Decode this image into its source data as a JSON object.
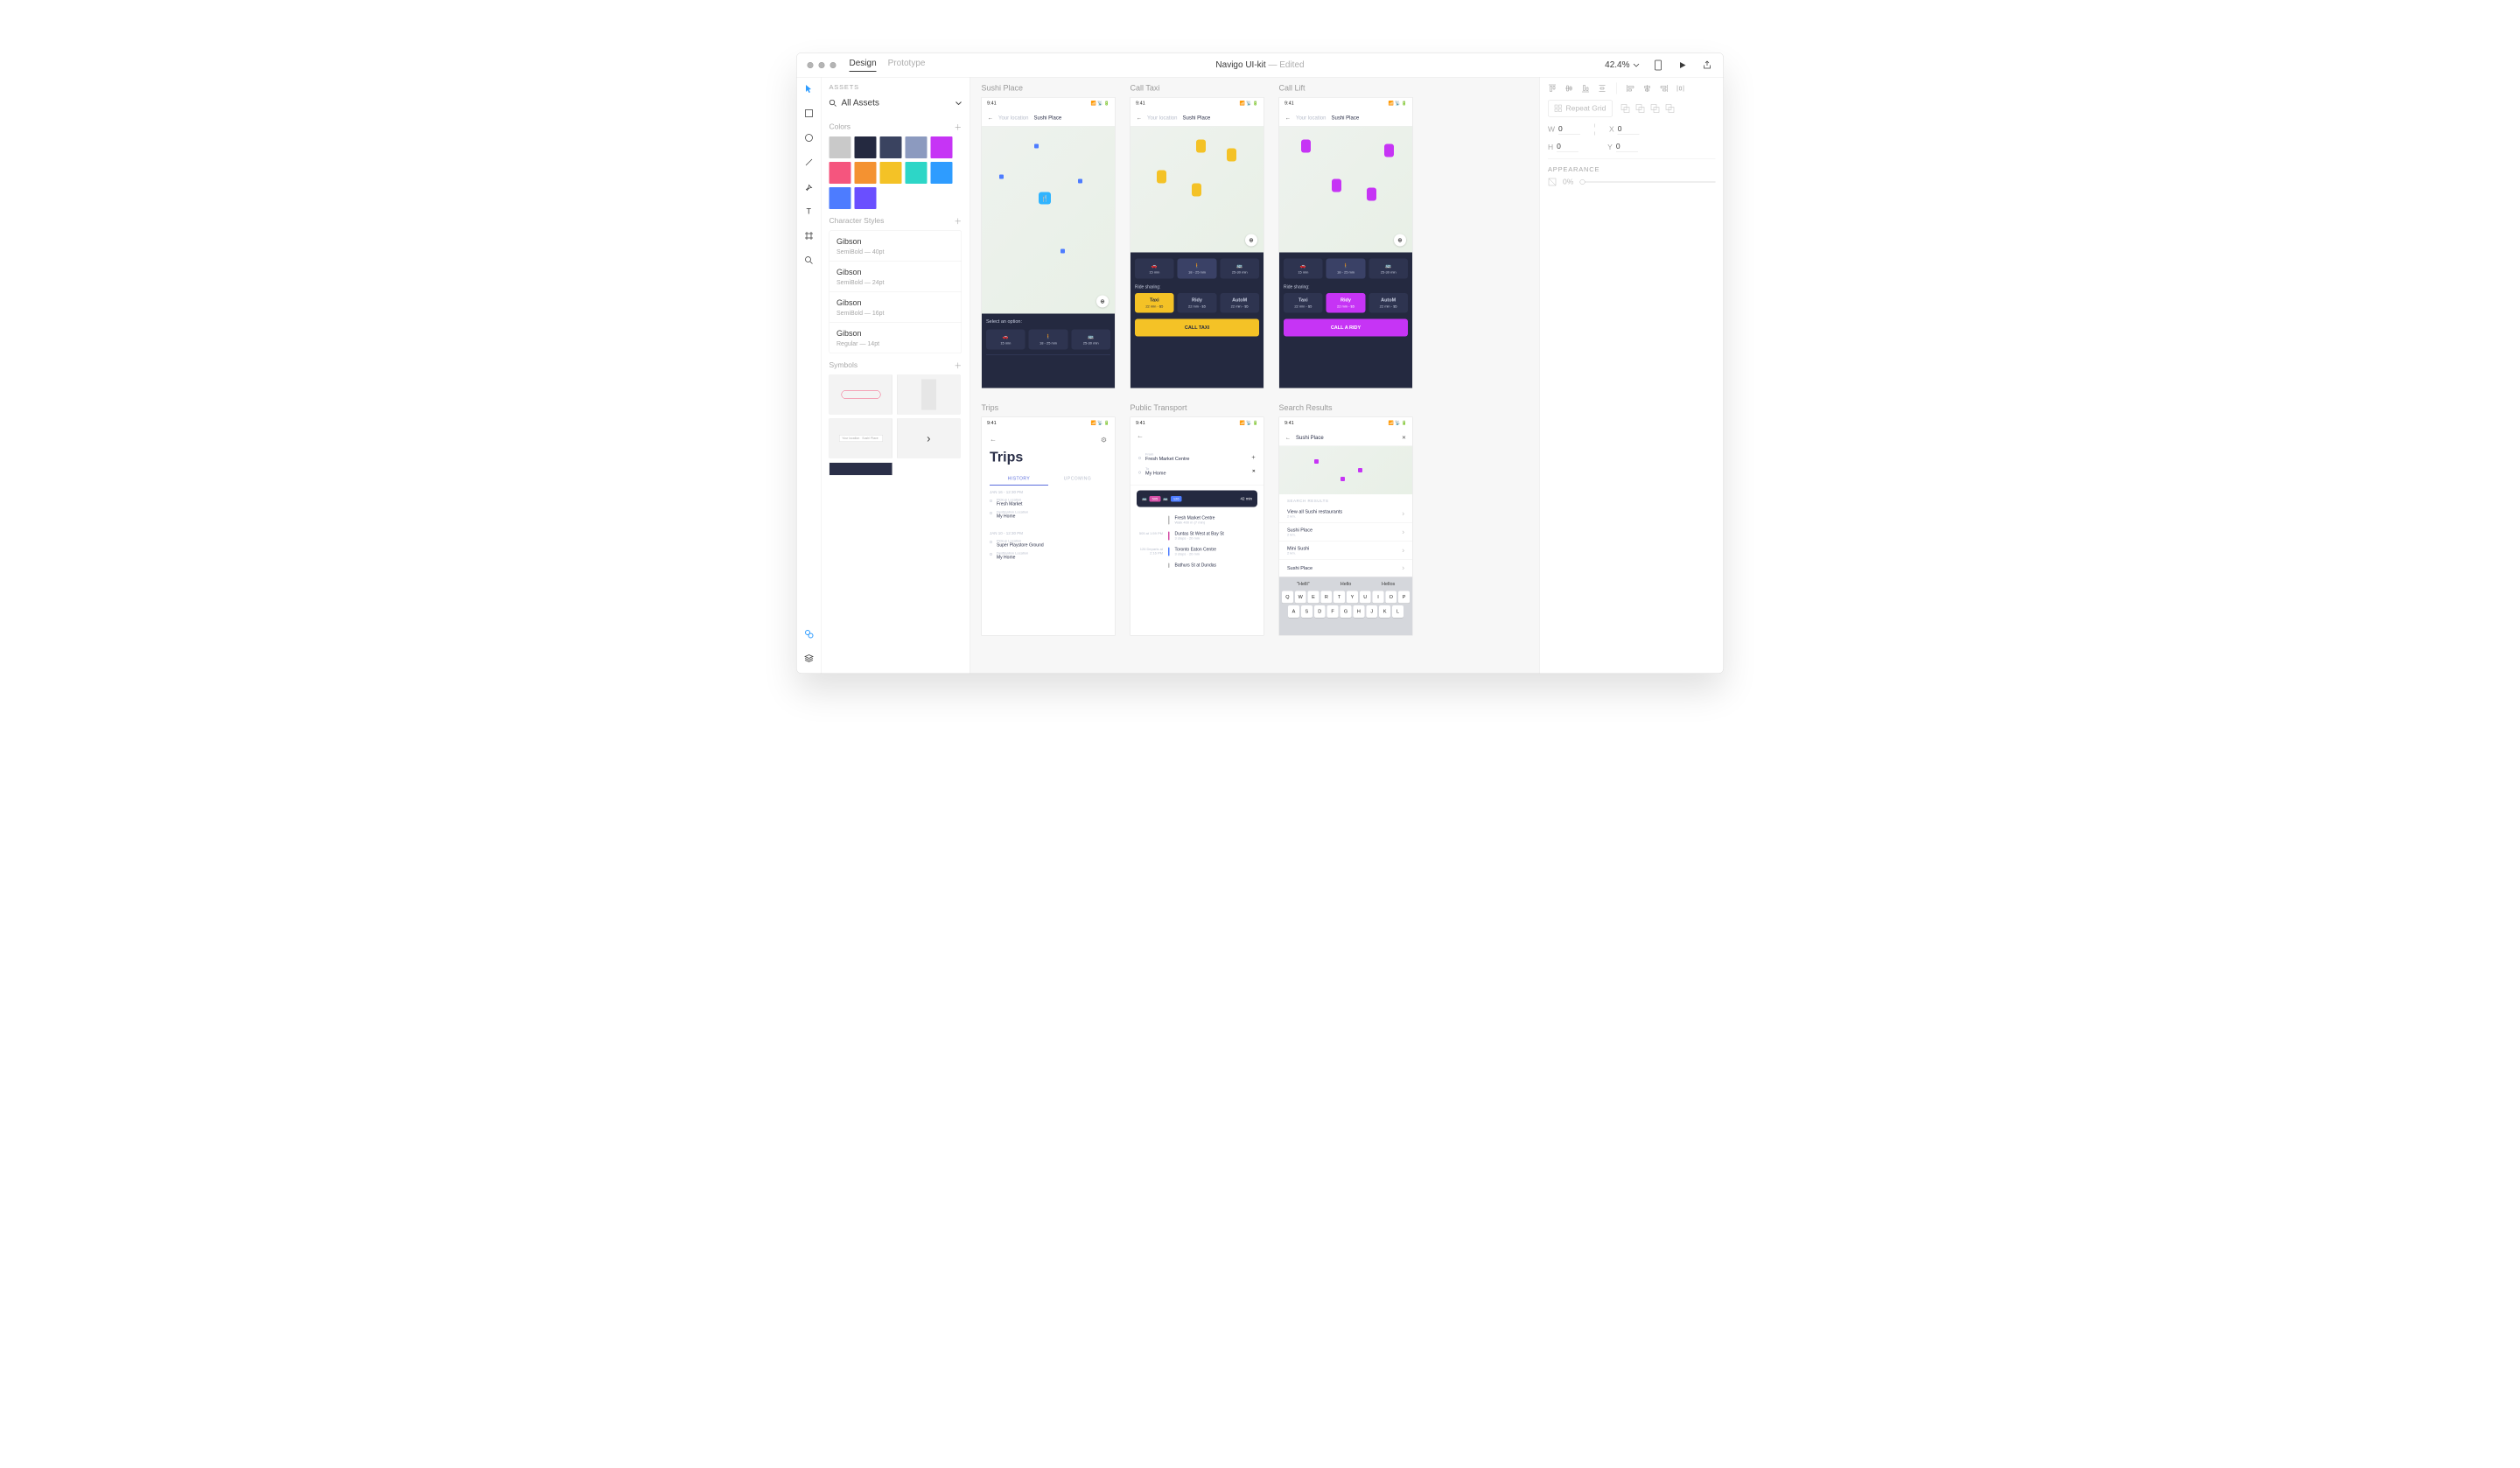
{
  "titlebar": {
    "tab_design": "Design",
    "tab_prototype": "Prototype",
    "doc_name": "Navigo UI-kit",
    "doc_status": "Edited",
    "zoom": "42.4%"
  },
  "assets": {
    "title": "ASSETS",
    "selector": "All Assets",
    "colors_title": "Colors",
    "colors": [
      "#c9c9c9",
      "#242940",
      "#3a4360",
      "#8c9abf",
      "#c634f5",
      "#f5557e",
      "#f49231",
      "#f4c226",
      "#2dd6c7",
      "#2e9cff",
      "#4d7cff",
      "#6a4fff"
    ],
    "char_styles_title": "Character Styles",
    "styles": [
      {
        "name": "Gibson",
        "meta": "SemiBold — 40pt"
      },
      {
        "name": "Gibson",
        "meta": "SemiBold — 24pt"
      },
      {
        "name": "Gibson",
        "meta": "SemiBold — 16pt"
      },
      {
        "name": "Gibson",
        "meta": "Regular — 14pt"
      }
    ],
    "symbols_title": "Symbols"
  },
  "artboards": {
    "sushi": {
      "title": "Sushi Place",
      "time": "9:41",
      "your_location": "Your location",
      "dest": "Sushi Place",
      "select_label": "Select an option:",
      "opts": [
        {
          "icon": "🚗",
          "label": "15 min"
        },
        {
          "icon": "🚶",
          "label": "18 - 25 min"
        },
        {
          "icon": "🚌",
          "label": "25-30 min"
        }
      ]
    },
    "taxi": {
      "title": "Call Taxi",
      "time": "9:41",
      "your_location": "Your location",
      "dest": "Sushi Place",
      "opts": [
        {
          "icon": "🚗",
          "label": "15 min"
        },
        {
          "icon": "🚶",
          "label": "18 - 25 min"
        },
        {
          "icon": "🚌",
          "label": "25-30 min"
        }
      ],
      "share_label": "Ride sharing:",
      "shares": [
        {
          "name": "Taxi",
          "sub": "22 min - $5"
        },
        {
          "name": "Ridy",
          "sub": "22 min - $5"
        },
        {
          "name": "AutoM",
          "sub": "22 min - $5"
        }
      ],
      "cta": "CALL TAXI"
    },
    "lift": {
      "title": "Call Lift",
      "time": "9:41",
      "your_location": "Your location",
      "dest": "Sushi Place",
      "opts": [
        {
          "icon": "🚗",
          "label": "15 min"
        },
        {
          "icon": "🚶",
          "label": "18 - 25 min"
        },
        {
          "icon": "🚌",
          "label": "25-30 min"
        }
      ],
      "share_label": "Ride sharing:",
      "shares": [
        {
          "name": "Taxi",
          "sub": "22 min - $5"
        },
        {
          "name": "Ridy",
          "sub": "22 min - $5"
        },
        {
          "name": "AutoM",
          "sub": "22 min - $5"
        }
      ],
      "cta": "CALL A RIDY"
    },
    "trips": {
      "title": "Trips",
      "time": "9:41",
      "heading": "Trips",
      "tab_history": "HISTORY",
      "tab_upcoming": "UPCOMING",
      "items": [
        {
          "date": "JAN 16 - 12:30 PM",
          "pickup_label": "Pickup Location",
          "pickup": "Fresh Market",
          "dest_label": "Destination Location",
          "dest": "My Home"
        },
        {
          "date": "JAN 10 - 12:30 PM",
          "pickup_label": "Pickup Location",
          "pickup": "Super Playstore Ground",
          "dest_label": "Destination Location",
          "dest": "My Home"
        }
      ]
    },
    "transport": {
      "title": "Public Transport",
      "time": "9:41",
      "from_label": "From",
      "from": "Fresh Market Centre",
      "to_label": "To",
      "to": "My Home",
      "pill_badge1": "505",
      "pill_badge2": "126",
      "pill_time": "42 min",
      "steps": [
        {
          "left": "",
          "title": "Fresh Market Centre",
          "sub": "Walk 400 m (7 min)"
        },
        {
          "left": "505\nat 1:59 PM",
          "title": "Duntas St West at Bay St",
          "sub": "3 stops · 20 min"
        },
        {
          "left": "126\nDeparts at 2:16 PM",
          "title": "Toronto Eaton Centre",
          "sub": "3 stops · 20 min"
        },
        {
          "left": "",
          "title": "Bathurs St at Dundas",
          "sub": ""
        }
      ]
    },
    "search": {
      "title": "Search Results",
      "time": "9:41",
      "query": "Sushi Place",
      "header": "SEARCH RESULTS",
      "results": [
        {
          "t": "View all Sushi restaurants",
          "s": "2 km."
        },
        {
          "t": "Sushi Place",
          "s": "2 km."
        },
        {
          "t": "Mini Sushi",
          "s": "2 km."
        },
        {
          "t": "Sushi Place",
          "s": ""
        }
      ],
      "suggestions": [
        "\"Helli\"",
        "Hello",
        "Hellos"
      ],
      "keys_row1": [
        "Q",
        "W",
        "E",
        "R",
        "T",
        "Y",
        "U",
        "I",
        "O",
        "P"
      ],
      "keys_row2": [
        "A",
        "S",
        "D",
        "F",
        "G",
        "H",
        "J",
        "K",
        "L"
      ]
    }
  },
  "inspector": {
    "repeat_grid": "Repeat Grid",
    "w_label": "W",
    "w_val": "0",
    "x_label": "X",
    "x_val": "0",
    "h_label": "H",
    "h_val": "0",
    "y_label": "Y",
    "y_val": "0",
    "appearance": "APPEARANCE",
    "opacity": "0%"
  }
}
